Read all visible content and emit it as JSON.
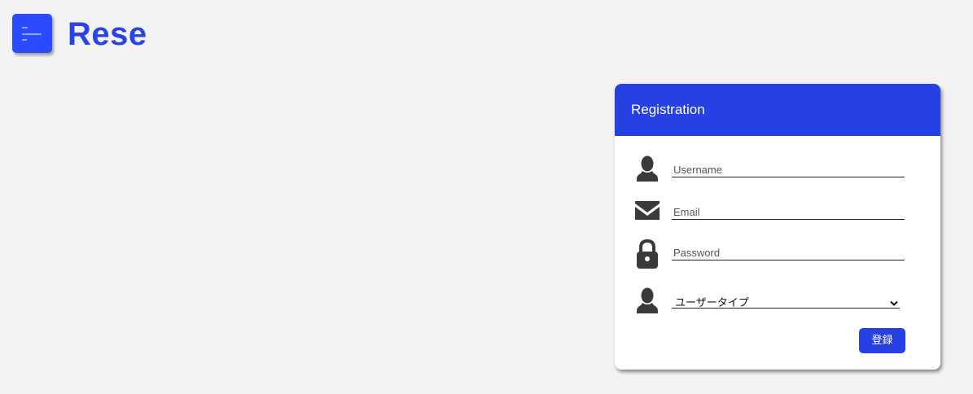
{
  "header": {
    "brand": "Rese",
    "menu_icon": "menu-icon"
  },
  "colors": {
    "accent": "#2640e4",
    "menu_button": "#2a4bff",
    "background": "#f2f2f2"
  },
  "registration": {
    "title": "Registration",
    "username": {
      "placeholder": "Username",
      "icon": "user-icon"
    },
    "email": {
      "placeholder": "Email",
      "icon": "envelope-icon"
    },
    "password": {
      "placeholder": "Password",
      "icon": "lock-icon"
    },
    "user_type": {
      "selected": "ユーザータイプ",
      "icon": "user-icon"
    },
    "submit_label": "登録"
  }
}
